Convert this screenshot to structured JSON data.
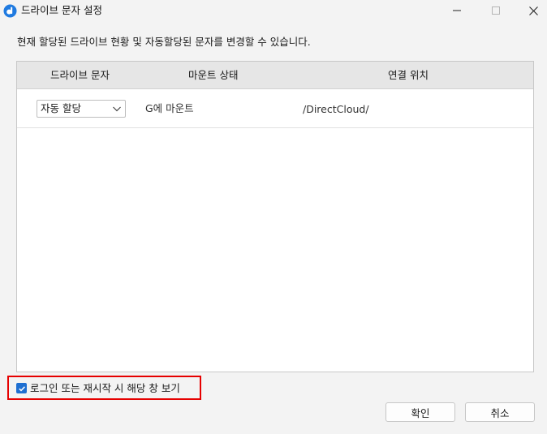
{
  "window": {
    "title": "드라이브 문자 설정"
  },
  "description": "현재 할당된 드라이브 현황 및 자동할당된 문자를 변경할 수 있습니다.",
  "table": {
    "headers": {
      "drive_letter": "드라이브 문자",
      "mount_status": "마운트 상태",
      "location": "연결 위치"
    },
    "rows": [
      {
        "drive_letter": "자동 할당",
        "mount_status": "G에 마운트",
        "location": "/DirectCloud/"
      }
    ]
  },
  "options": {
    "show_on_login_label": "로그인 또는 재시작 시 해당 창 보기",
    "show_on_login_checked": true
  },
  "buttons": {
    "ok": "확인",
    "cancel": "취소"
  },
  "colors": {
    "accent": "#1f6fd1",
    "highlight_border": "#e60000",
    "header_bg": "#e6e6e6",
    "window_bg": "#f3f3f3"
  },
  "icons": {
    "app": "directcloud-icon",
    "minimize": "minimize-icon",
    "maximize": "maximize-icon",
    "close": "close-icon",
    "dropdown": "chevron-down-icon",
    "check": "checkmark-icon"
  }
}
